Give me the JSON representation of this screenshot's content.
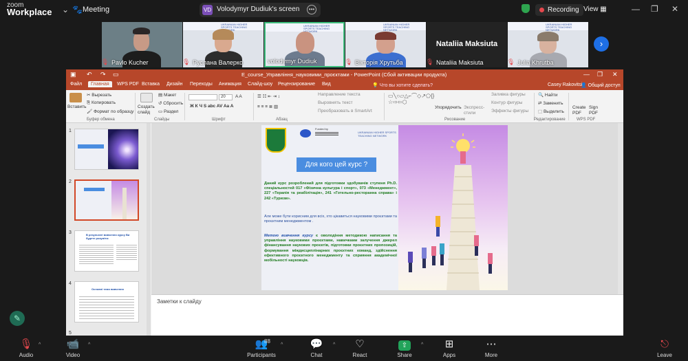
{
  "app": {
    "brand_line1": "zoom",
    "brand_line2": "Workplace",
    "meeting_label": "Meeting",
    "share_initials": "VD",
    "share_label": "Volodymyr Dudiuk's screen",
    "recording_label": "Recording",
    "view_label": "View"
  },
  "participants": [
    {
      "name": "Pavlo Kucher",
      "muted": true
    },
    {
      "name": "Руслана Валерко",
      "muted": true
    },
    {
      "name": "volodymyr Dudiuk",
      "muted": false
    },
    {
      "name": "Вікторія Хрутьба",
      "muted": true
    },
    {
      "name": "Nataliia Maksiuta",
      "muted": true,
      "video": false
    },
    {
      "name": "Julia Khrutba",
      "muted": true
    }
  ],
  "ppt": {
    "title": "E_course_Управління_науковими_проєктами - PowerPoint (Сбой активации продукта)",
    "tabs": [
      "Файл",
      "Главная",
      "WPS PDF",
      "Вставка",
      "Дизайн",
      "Переходы",
      "Анимация",
      "Слайд-шоу",
      "Рецензирование",
      "Вид"
    ],
    "active_tab": "Главная",
    "tell_me": "Что вы хотите сделать?",
    "user": "Casey Rakovitsi",
    "share": "Общий доступ",
    "ribbon": {
      "paste": "Вставить",
      "cut": "Вырезать",
      "copy": "Копировать",
      "format_painter": "Формат по образцу",
      "clipboard": "Буфер обмена",
      "create_slide": "Создать слайд",
      "layout": "Макет",
      "reset": "Сбросить",
      "section": "Раздел",
      "slides": "Слайды",
      "font_size": "20",
      "font": "Шрифт",
      "paragraph": "Абзац",
      "text_direction": "Направление текста",
      "align_text": "Выровнять текст",
      "smartart": "Преобразовать в SmartArt",
      "arrange": "Упорядочить",
      "quick_styles": "Экспресс-стили",
      "drawing": "Рисование",
      "shape_fill": "Заливка фигуры",
      "shape_outline": "Контур фигуры",
      "shape_effects": "Эффекты фигуры",
      "find": "Найти",
      "replace": "Заменить",
      "select": "Выделить",
      "editing": "Редактирование",
      "create_pdf": "Create PDF",
      "sign_pdf": "Sign PDF",
      "wps_pdf": "WPS PDF"
    },
    "slide_numbers": [
      "1",
      "2",
      "3",
      "4",
      "5"
    ],
    "thumb3_title": "В результаті  вивчення курсу Ви будете розуміти:",
    "thumb4_title": "Основні теми вивчення",
    "slide": {
      "funded_by": "Funded by",
      "network": "UKRAINIAN HIGHER SPORTS TEACHING NETWORK",
      "heading": "Для кого цей курс ?",
      "p1": "Даний курс розроблений для підготовки здобувачів ступеня Ph.D. спеціальностей 017 «Фізична культура і спорт», 073 «Менеджмент», 227 «Терапія та реабілітація», 241 «Готельно-ресторанна справа» і 242 «Туризм».",
      "p2": "Але може бути корисним для всіх, хто цікавиться науковими проєктами та проєктним менеджментом .",
      "p3_lead": "Метою вивчення курсу",
      "p3": " є оволодіння методикою написання та управління науковими проєктами, навичками залучення джерел фінансування наукових проєктів, підготовки проєктних пропозицій, формування міждисциплінарних проєктних команд, здійснення ефективного проєктного менеджменту та сприяння академічної мобільності науковців."
    },
    "notes_placeholder": "Заметки к слайду"
  },
  "toolbar": {
    "audio": "Audio",
    "video": "Video",
    "participants": "Participants",
    "participants_count": "88",
    "chat": "Chat",
    "react": "React",
    "share": "Share",
    "apps": "Apps",
    "more": "More",
    "leave": "Leave"
  },
  "colors": {
    "ppt_accent": "#b7472a",
    "zoom_blue": "#1e6fe5",
    "share_green": "#22a35a",
    "slide_heading": "#4a8de0",
    "slide_text_green": "#1d7a1d"
  }
}
